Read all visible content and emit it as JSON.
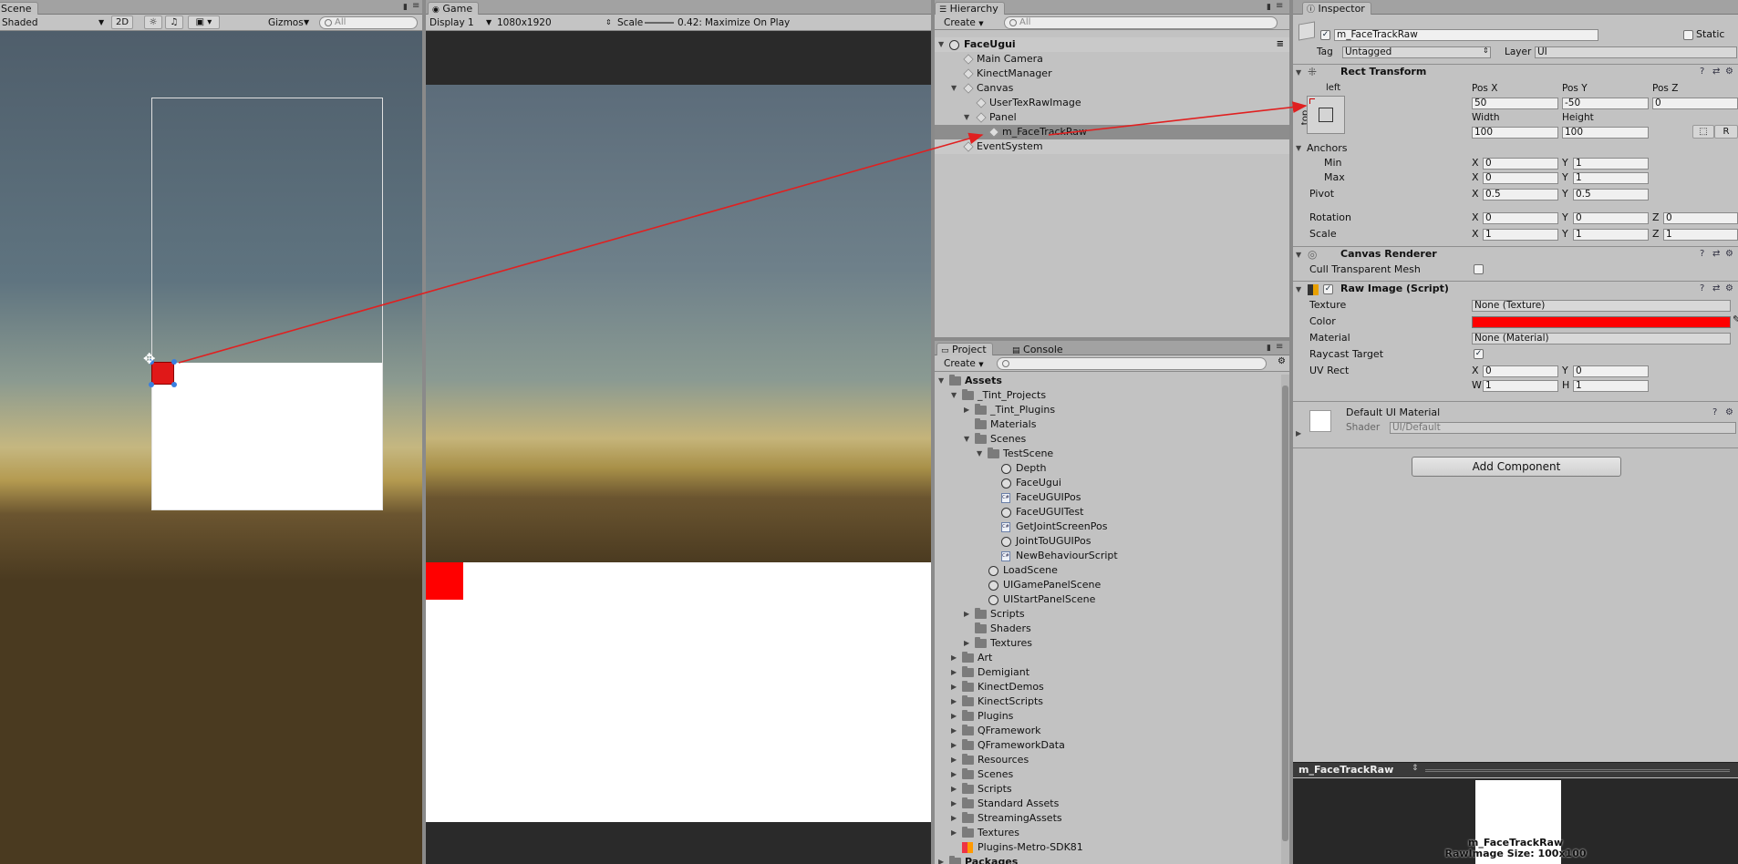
{
  "scene": {
    "tab": "Scene",
    "shading": "Shaded",
    "mode_2d": "2D",
    "gizmos": "Gizmos",
    "search_placeholder": "All",
    "sky_color": "#5a6b78",
    "ground_color": "#4a3a20",
    "panel_color": "#ffffff",
    "selected_color": "#e01818"
  },
  "game": {
    "tab": "Game",
    "display": "Display 1",
    "resolution": "1080x1920",
    "scale_label": "Scale",
    "scale_value": "0.42:",
    "maximize": "Maximize On Play"
  },
  "hierarchy": {
    "tab": "Hierarchy",
    "create": "Create",
    "search_placeholder": "All",
    "items": [
      {
        "label": "FaceUgui"
      },
      {
        "label": "Main Camera"
      },
      {
        "label": "KinectManager"
      },
      {
        "label": "Canvas"
      },
      {
        "label": "UserTexRawImage"
      },
      {
        "label": "Panel"
      },
      {
        "label": "m_FaceTrackRaw"
      },
      {
        "label": "EventSystem"
      }
    ]
  },
  "project": {
    "tab": "Project",
    "console_tab": "Console",
    "create": "Create",
    "items": [
      {
        "label": "Assets"
      },
      {
        "label": "_Tint_Projects"
      },
      {
        "label": "_Tint_Plugins"
      },
      {
        "label": "Materials"
      },
      {
        "label": "Scenes"
      },
      {
        "label": "TestScene"
      },
      {
        "label": "Depth"
      },
      {
        "label": "FaceUgui"
      },
      {
        "label": "FaceUGUIPos"
      },
      {
        "label": "FaceUGUITest"
      },
      {
        "label": "GetJointScreenPos"
      },
      {
        "label": "JointToUGUIPos"
      },
      {
        "label": "NewBehaviourScript"
      },
      {
        "label": "LoadScene"
      },
      {
        "label": "UIGamePanelScene"
      },
      {
        "label": "UIStartPanelScene"
      },
      {
        "label": "Scripts"
      },
      {
        "label": "Shaders"
      },
      {
        "label": "Textures"
      },
      {
        "label": "Art"
      },
      {
        "label": "Demigiant"
      },
      {
        "label": "KinectDemos"
      },
      {
        "label": "KinectScripts"
      },
      {
        "label": "Plugins"
      },
      {
        "label": "QFramework"
      },
      {
        "label": "QFrameworkData"
      },
      {
        "label": "Resources"
      },
      {
        "label": "Scenes"
      },
      {
        "label": "Scripts"
      },
      {
        "label": "Standard Assets"
      },
      {
        "label": "StreamingAssets"
      },
      {
        "label": "Textures"
      },
      {
        "label": "Plugins-Metro-SDK81"
      },
      {
        "label": "Packages"
      }
    ]
  },
  "inspector": {
    "tab": "Inspector",
    "object_name": "m_FaceTrackRaw",
    "static": "Static",
    "tag_label": "Tag",
    "tag_value": "Untagged",
    "layer_label": "Layer",
    "layer_value": "UI",
    "rect_transform": {
      "title": "Rect Transform",
      "anchor_h": "left",
      "anchor_v": "top",
      "pos_x_label": "Pos X",
      "pos_y_label": "Pos Y",
      "pos_z_label": "Pos Z",
      "pos_x": "50",
      "pos_y": "-50",
      "pos_z": "0",
      "width_label": "Width",
      "height_label": "Height",
      "width": "100",
      "height": "100",
      "r_button": "R",
      "anchors_label": "Anchors",
      "min_label": "Min",
      "max_label": "Max",
      "min_x": "0",
      "min_y": "1",
      "max_x": "0",
      "max_y": "1",
      "pivot_label": "Pivot",
      "pivot_x": "0.5",
      "pivot_y": "0.5",
      "rotation_label": "Rotation",
      "rot_x": "0",
      "rot_y": "0",
      "rot_z": "0",
      "scale_label": "Scale",
      "scale_x": "1",
      "scale_y": "1",
      "scale_z": "1",
      "x": "X",
      "y": "Y",
      "z": "Z"
    },
    "canvas_renderer": {
      "title": "Canvas Renderer",
      "cull_label": "Cull Transparent Mesh"
    },
    "raw_image": {
      "title": "Raw Image (Script)",
      "texture_label": "Texture",
      "texture_value": "None (Texture)",
      "color_label": "Color",
      "color_value": "#ff0000",
      "material_label": "Material",
      "material_value": "None (Material)",
      "raycast_label": "Raycast Target",
      "uvrect_label": "UV Rect",
      "uv_x": "0",
      "uv_y": "0",
      "uv_w": "1",
      "uv_h": "1",
      "w": "W",
      "h": "H"
    },
    "material": {
      "title": "Default UI Material",
      "shader_label": "Shader",
      "shader_value": "UI/Default"
    },
    "add_component": "Add Component",
    "preview": {
      "title": "m_FaceTrackRaw",
      "caption_name": "m_FaceTrackRaw",
      "caption_size": "RawImage Size: 100x100"
    }
  }
}
